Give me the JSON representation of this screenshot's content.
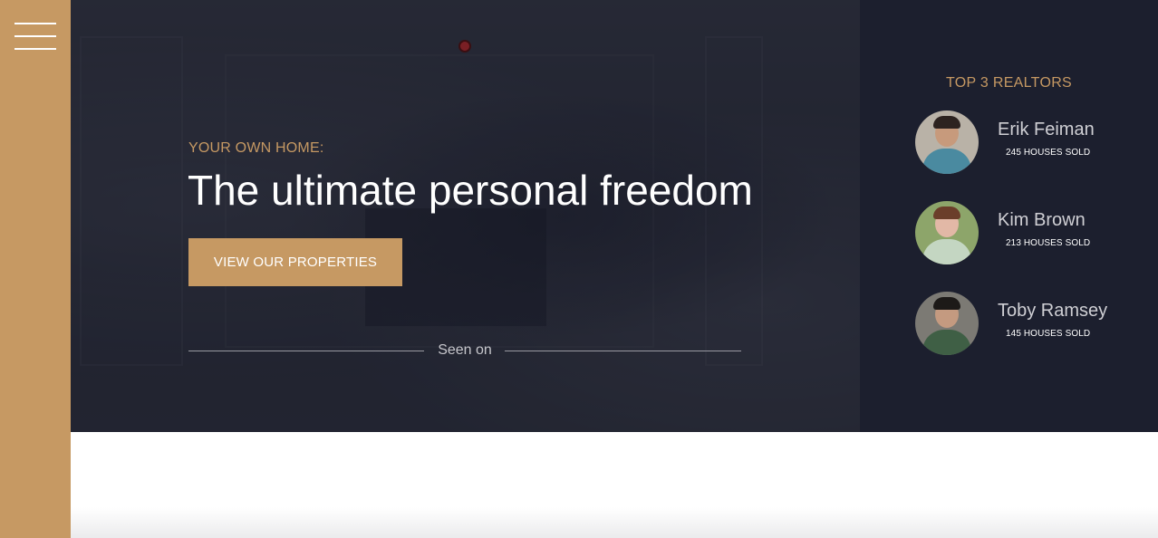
{
  "hero": {
    "subtitle": "YOUR OWN HOME:",
    "title": "The ultimate personal freedom",
    "cta_label": "VIEW OUR PROPERTIES",
    "seen_on_label": "Seen on"
  },
  "realtors": {
    "title": "TOP 3 REALTORS",
    "items": [
      {
        "name": "Erik Feiman",
        "sold": "245 HOUSES SOLD"
      },
      {
        "name": "Kim Brown",
        "sold": "213 HOUSES SOLD"
      },
      {
        "name": "Toby Ramsey",
        "sold": "145 HOUSES SOLD"
      }
    ]
  },
  "colors": {
    "accent": "#c69963",
    "panel_dark": "#1c1f2e",
    "hero_text": "#ffffff"
  },
  "icons": {
    "menu": "hamburger-menu-icon",
    "logo": "logo-icon"
  }
}
